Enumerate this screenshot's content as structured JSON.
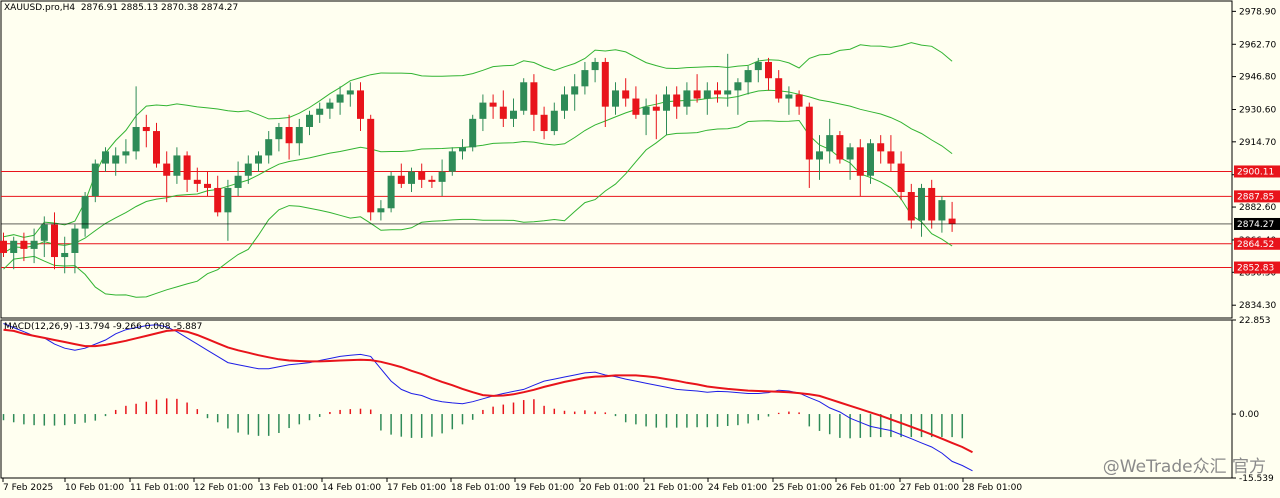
{
  "header": {
    "symbol_info": "XAUUSD.pro,H4",
    "ohlc": "2876.91 2885.13 2870.38 2874.27"
  },
  "macd": {
    "label": "MACD(12,26,9)",
    "values": "-13.794 -9.266 0.008 -5.887"
  },
  "watermark": "@WeTrade众汇 官方",
  "colors": {
    "bull": "#2e8b57",
    "bear": "#e8141b",
    "band": "#32b432",
    "macd_line": "#1e1ee6",
    "signal_line": "#e8141b",
    "hline": "#e8141b",
    "background": "#fffff0"
  },
  "price_scale": {
    "ticks": [
      "2978.90",
      "2962.70",
      "2946.80",
      "2930.60",
      "2914.70",
      "2898.50",
      "2882.60",
      "2866.40",
      "2850.50",
      "2834.30"
    ],
    "current": "2874.27"
  },
  "macd_scale": {
    "ticks": [
      "22.853",
      "0.00",
      "-15.539"
    ]
  },
  "horizontal_lines": [
    {
      "value": "2900.11"
    },
    {
      "value": "2887.85"
    },
    {
      "value": "2864.52"
    },
    {
      "value": "2852.83"
    }
  ],
  "time_labels": [
    "7 Feb 2025",
    "10 Feb 01:00",
    "11 Feb 01:00",
    "12 Feb 01:00",
    "13 Feb 01:00",
    "14 Feb 01:00",
    "17 Feb 01:00",
    "18 Feb 01:00",
    "19 Feb 01:00",
    "20 Feb 01:00",
    "21 Feb 01:00",
    "24 Feb 01:00",
    "25 Feb 01:00",
    "26 Feb 01:00",
    "27 Feb 01:00",
    "28 Feb 01:00"
  ],
  "chart_data": [
    {
      "type": "candlestick",
      "title": "XAUUSD.pro,H4",
      "ylim": [
        2828,
        2984
      ],
      "candles": [
        [
          2866,
          2870,
          2858,
          2860
        ],
        [
          2860,
          2868,
          2852,
          2866
        ],
        [
          2866,
          2870,
          2856,
          2862
        ],
        [
          2862,
          2872,
          2855,
          2866
        ],
        [
          2866,
          2878,
          2858,
          2874
        ],
        [
          2874,
          2880,
          2852,
          2858
        ],
        [
          2858,
          2868,
          2850,
          2860
        ],
        [
          2860,
          2874,
          2850,
          2872
        ],
        [
          2872,
          2890,
          2868,
          2888
        ],
        [
          2888,
          2906,
          2885,
          2904
        ],
        [
          2904,
          2912,
          2900,
          2910
        ],
        [
          2904,
          2912,
          2898,
          2908
        ],
        [
          2908,
          2916,
          2904,
          2910
        ],
        [
          2910,
          2942,
          2906,
          2922
        ],
        [
          2922,
          2928,
          2912,
          2920
        ],
        [
          2920,
          2924,
          2902,
          2904
        ],
        [
          2904,
          2910,
          2885,
          2898
        ],
        [
          2898,
          2912,
          2894,
          2908
        ],
        [
          2908,
          2910,
          2890,
          2896
        ],
        [
          2896,
          2902,
          2890,
          2894
        ],
        [
          2894,
          2900,
          2888,
          2892
        ],
        [
          2892,
          2898,
          2878,
          2880
        ],
        [
          2880,
          2896,
          2866,
          2892
        ],
        [
          2892,
          2905,
          2888,
          2898
        ],
        [
          2898,
          2908,
          2894,
          2904
        ],
        [
          2904,
          2910,
          2900,
          2908
        ],
        [
          2908,
          2920,
          2904,
          2916
        ],
        [
          2916,
          2924,
          2910,
          2922
        ],
        [
          2922,
          2928,
          2906,
          2914
        ],
        [
          2914,
          2926,
          2908,
          2922
        ],
        [
          2922,
          2930,
          2918,
          2928
        ],
        [
          2928,
          2934,
          2924,
          2931
        ],
        [
          2931,
          2936,
          2926,
          2934
        ],
        [
          2934,
          2942,
          2928,
          2938
        ],
        [
          2938,
          2944,
          2932,
          2940
        ],
        [
          2940,
          2944,
          2920,
          2926
        ],
        [
          2926,
          2928,
          2876,
          2880
        ],
        [
          2880,
          2886,
          2876,
          2882
        ],
        [
          2882,
          2900,
          2880,
          2898
        ],
        [
          2898,
          2904,
          2892,
          2894
        ],
        [
          2894,
          2902,
          2890,
          2900
        ],
        [
          2900,
          2904,
          2892,
          2896
        ],
        [
          2896,
          2898,
          2892,
          2895
        ],
        [
          2895,
          2906,
          2888,
          2900
        ],
        [
          2900,
          2912,
          2898,
          2910
        ],
        [
          2910,
          2916,
          2906,
          2912
        ],
        [
          2912,
          2928,
          2910,
          2926
        ],
        [
          2926,
          2938,
          2920,
          2934
        ],
        [
          2934,
          2938,
          2926,
          2932
        ],
        [
          2932,
          2940,
          2922,
          2926
        ],
        [
          2926,
          2936,
          2922,
          2930
        ],
        [
          2930,
          2946,
          2928,
          2944
        ],
        [
          2944,
          2948,
          2920,
          2928
        ],
        [
          2928,
          2932,
          2916,
          2920
        ],
        [
          2920,
          2934,
          2918,
          2930
        ],
        [
          2930,
          2942,
          2926,
          2938
        ],
        [
          2938,
          2948,
          2930,
          2942
        ],
        [
          2942,
          2954,
          2938,
          2950
        ],
        [
          2950,
          2956,
          2944,
          2954
        ],
        [
          2954,
          2956,
          2922,
          2932
        ],
        [
          2932,
          2944,
          2928,
          2940
        ],
        [
          2940,
          2946,
          2932,
          2936
        ],
        [
          2936,
          2942,
          2926,
          2928
        ],
        [
          2928,
          2936,
          2918,
          2932
        ],
        [
          2932,
          2938,
          2916,
          2930
        ],
        [
          2930,
          2942,
          2918,
          2938
        ],
        [
          2938,
          2942,
          2926,
          2932
        ],
        [
          2932,
          2944,
          2928,
          2940
        ],
        [
          2940,
          2948,
          2934,
          2936
        ],
        [
          2936,
          2944,
          2928,
          2940
        ],
        [
          2940,
          2944,
          2934,
          2938
        ],
        [
          2938,
          2958,
          2932,
          2940
        ],
        [
          2940,
          2946,
          2928,
          2944
        ],
        [
          2944,
          2952,
          2938,
          2950
        ],
        [
          2950,
          2956,
          2944,
          2954
        ],
        [
          2954,
          2956,
          2940,
          2946
        ],
        [
          2946,
          2950,
          2934,
          2936
        ],
        [
          2936,
          2942,
          2928,
          2938
        ],
        [
          2938,
          2940,
          2928,
          2932
        ],
        [
          2932,
          2934,
          2892,
          2906
        ],
        [
          2906,
          2918,
          2896,
          2910
        ],
        [
          2910,
          2926,
          2904,
          2918
        ],
        [
          2918,
          2920,
          2904,
          2906
        ],
        [
          2906,
          2914,
          2896,
          2912
        ],
        [
          2912,
          2916,
          2888,
          2898
        ],
        [
          2898,
          2916,
          2894,
          2914
        ],
        [
          2914,
          2918,
          2904,
          2910
        ],
        [
          2910,
          2918,
          2900,
          2904
        ],
        [
          2904,
          2910,
          2886,
          2890
        ],
        [
          2890,
          2894,
          2872,
          2876
        ],
        [
          2876,
          2894,
          2868,
          2892
        ],
        [
          2892,
          2896,
          2872,
          2876
        ],
        [
          2876,
          2888,
          2870,
          2886
        ],
        [
          2876.91,
          2885.13,
          2870.38,
          2874.27
        ]
      ]
    },
    {
      "type": "line",
      "title": "MACD(12,26,9)",
      "ylim": [
        -15.539,
        22.853
      ],
      "series": [
        {
          "name": "MACD",
          "values": [
            22,
            21,
            20,
            19,
            18.5,
            17,
            16,
            15.5,
            16,
            17,
            18,
            19.5,
            20.5,
            21,
            21.5,
            21.7,
            21.2,
            20,
            18.5,
            17,
            15.5,
            14,
            12.5,
            12,
            11.5,
            11,
            11,
            11.5,
            12,
            12.2,
            12.5,
            13,
            13.5,
            14,
            14.3,
            14.5,
            14,
            11,
            8,
            6,
            5,
            4.5,
            3.5,
            3,
            2.7,
            2.5,
            3,
            3.7,
            4.4,
            5,
            5.5,
            6,
            7,
            8,
            8.5,
            9,
            9.5,
            10,
            10.2,
            9.5,
            9.1,
            8.5,
            8,
            7.5,
            7,
            6.5,
            6,
            5.8,
            5.6,
            5.3,
            5.5,
            5.4,
            5.2,
            5,
            5,
            5.2,
            5.8,
            5.6,
            5.1,
            4,
            3,
            1.5,
            0.5,
            -1,
            -2,
            -3,
            -3.5,
            -4,
            -5,
            -6,
            -7,
            -8,
            -9.5,
            -11.5,
            -12.5,
            -13.8
          ]
        },
        {
          "name": "Signal",
          "values": [
            20.5,
            20.2,
            19.5,
            19,
            18.5,
            18,
            17.5,
            17,
            16.5,
            16.5,
            16.8,
            17.3,
            17.8,
            18.4,
            19,
            19.6,
            20.2,
            20.4,
            20,
            19.2,
            18.2,
            17.2,
            16.2,
            15.5,
            14.9,
            14.3,
            13.8,
            13.3,
            13,
            12.9,
            12.8,
            12.8,
            12.9,
            13,
            13.1,
            13.2,
            13.1,
            12.7,
            12.1,
            11.4,
            10.5,
            9.7,
            8.7,
            7.8,
            7,
            6.1,
            5.3,
            4.6,
            4.4,
            4.5,
            4.8,
            5.3,
            5.9,
            6.6,
            7.2,
            7.8,
            8.3,
            8.8,
            9.1,
            9.2,
            9.4,
            9.4,
            9.4,
            9.2,
            8.9,
            8.5,
            8.1,
            7.6,
            7.2,
            6.7,
            6.4,
            6.1,
            5.9,
            5.7,
            5.6,
            5.5,
            5.4,
            5.3,
            5.1,
            4.8,
            4.4,
            3.6,
            2.8,
            2,
            1.2,
            0.4,
            -0.4,
            -1.3,
            -2.2,
            -3.1,
            -4,
            -5,
            -6,
            -7,
            -8,
            -9.3
          ]
        },
        {
          "name": "OsMA",
          "values": [
            -1.5,
            -2,
            -2.5,
            -2.7,
            -2.8,
            -2.8,
            -2.7,
            -2.4,
            -2.1,
            -1.6,
            -0.5,
            1,
            2,
            2.5,
            3,
            3.5,
            3.8,
            3.7,
            2.8,
            1.2,
            -1,
            -2,
            -3.5,
            -4.5,
            -5,
            -5.3,
            -5.3,
            -4.6,
            -3.4,
            -2.5,
            -1.5,
            -0.7,
            0.5,
            1,
            1.2,
            1.3,
            1.1,
            -4,
            -5,
            -5.5,
            -5.8,
            -5.8,
            -5.5,
            -4.7,
            -3.7,
            -2.5,
            -1.4,
            1,
            1.8,
            2.3,
            2.8,
            3.4,
            3.6,
            2,
            1.3,
            0.8,
            0.6,
            0.9,
            0.6,
            0.4,
            -0.5,
            -2,
            -2.5,
            -3,
            -3.3,
            -3.3,
            -3.3,
            -3.3,
            -3.2,
            -3.2,
            -3.1,
            -2.9,
            -2.7,
            -2.3,
            -1.5,
            -0.6,
            0.3,
            0.6,
            0.4,
            -3,
            -4.1,
            -4.9,
            -5.8,
            -5.9,
            -5.8,
            -5.6,
            -5.6,
            -5.6,
            -5.6,
            -5.6,
            -5.6,
            -5.6,
            -5.6,
            -5.6,
            -5.887
          ]
        }
      ]
    }
  ]
}
